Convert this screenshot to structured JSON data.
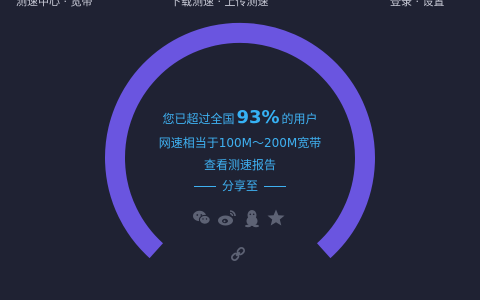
{
  "top_bar": {
    "fragments": [
      "测速中心 · 宽带",
      "下载测速 · 上传测速",
      "登录 · 设置"
    ]
  },
  "gauge": {
    "color": "#6a55e0",
    "background": "#1f2233"
  },
  "result": {
    "prefix": "您已超过全国",
    "percent": "93%",
    "suffix": "的用户",
    "bandwidth_text": "网速相当于100M～200M宽带",
    "report_link": "查看测速报告",
    "share_label": "分享至"
  },
  "share_icons": [
    "wechat-icon",
    "weibo-icon",
    "qq-icon",
    "favorite-star-icon"
  ],
  "colors": {
    "accent_text": "#3fb0f0",
    "icon_gray": "#5d6274"
  }
}
